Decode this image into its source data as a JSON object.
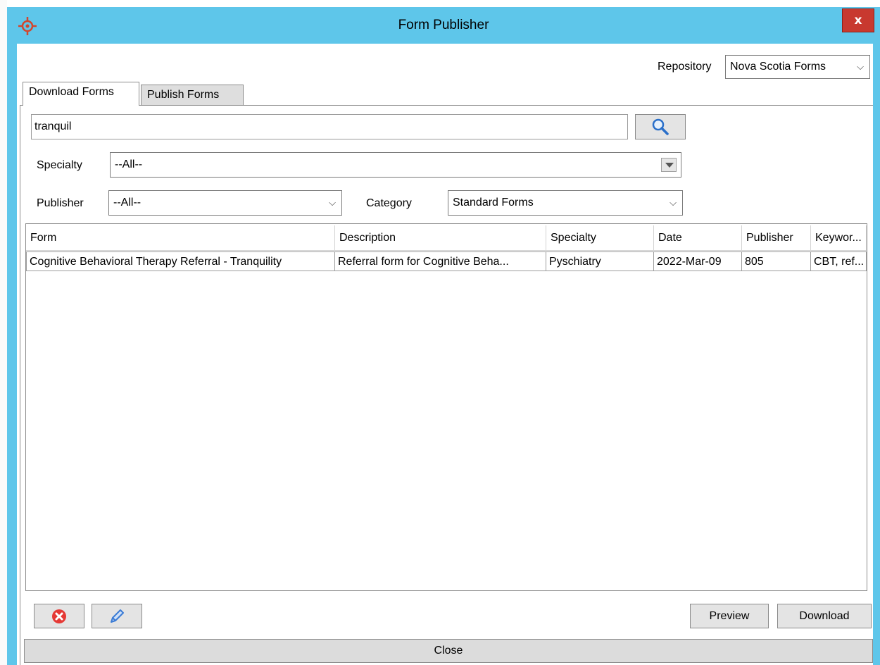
{
  "window": {
    "title": "Form Publisher",
    "close_glyph": "x"
  },
  "repository": {
    "label": "Repository",
    "selected": "Nova Scotia Forms"
  },
  "tabs": [
    {
      "label": "Download Forms",
      "active": true
    },
    {
      "label": "Publish Forms",
      "active": false
    }
  ],
  "search": {
    "value": "tranquil",
    "button_icon": "magnifier-icon"
  },
  "filters": {
    "specialty_label": "Specialty",
    "specialty_value": "--All--",
    "publisher_label": "Publisher",
    "publisher_value": "--All--",
    "category_label": "Category",
    "category_value": "Standard Forms"
  },
  "table": {
    "columns": [
      "Form",
      "Description",
      "Specialty",
      "Date",
      "Publisher",
      "Keywor..."
    ],
    "rows": [
      [
        "Cognitive Behavioral Therapy Referral - Tranquility",
        "Referral form for Cognitive Beha...",
        "Pyschiatry",
        "2022-Mar-09",
        "805",
        "CBT, ref..."
      ]
    ]
  },
  "actions": {
    "delete_icon": "delete-icon",
    "edit_icon": "pencil-icon",
    "preview_label": "Preview",
    "download_label": "Download",
    "close_label": "Close"
  },
  "colors": {
    "title_bar": "#5ec6ea",
    "close_button": "#c8392f",
    "delete_icon": "#e53935",
    "edit_icon": "#3a7bd5",
    "search_icon": "#2a6fc9"
  }
}
